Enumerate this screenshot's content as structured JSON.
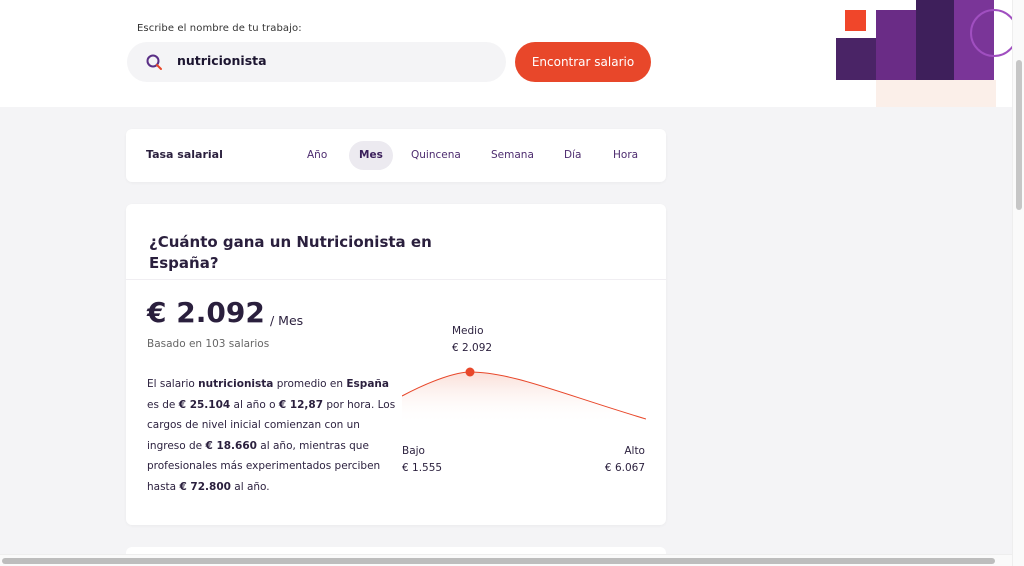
{
  "search": {
    "label": "Escribe el nombre de tu trabajo:",
    "value": "nutricionista",
    "button_label": "Encontrar salario"
  },
  "rate": {
    "title": "Tasa salarial",
    "tabs": [
      {
        "label": "Año",
        "active": false
      },
      {
        "label": "Mes",
        "active": true
      },
      {
        "label": "Quincena",
        "active": false
      },
      {
        "label": "Semana",
        "active": false
      },
      {
        "label": "Día",
        "active": false
      },
      {
        "label": "Hora",
        "active": false
      }
    ]
  },
  "salary": {
    "heading": "¿Cuánto gana un Nutricionista en España?",
    "amount": "€ 2.092",
    "period": "/ Mes",
    "based_on": "Basado en 103 salarios",
    "desc": {
      "p1": "El salario ",
      "job": "nutricionista",
      "p2": " promedio en ",
      "country": "España",
      "p3": " es de ",
      "yearly": "€ 25.104",
      "p4": " al año o ",
      "hourly": "€ 12,87",
      "p5": " por hora. Los cargos de nivel inicial comienzan con un ingreso de ",
      "entry": "€ 18.660",
      "p6": " al año, mientras que profesionales más experimentados perciben hasta ",
      "max": "€ 72.800",
      "p7": " al año."
    },
    "distribution": {
      "medio_label": "Medio",
      "medio_value": "€ 2.092",
      "bajo_label": "Bajo",
      "bajo_value": "€ 1.555",
      "alto_label": "Alto",
      "alto_value": "€ 6.067"
    }
  },
  "colors": {
    "accent": "#e8472a",
    "brand_purple": "#4d2c6f",
    "text": "#2a1f3d"
  }
}
